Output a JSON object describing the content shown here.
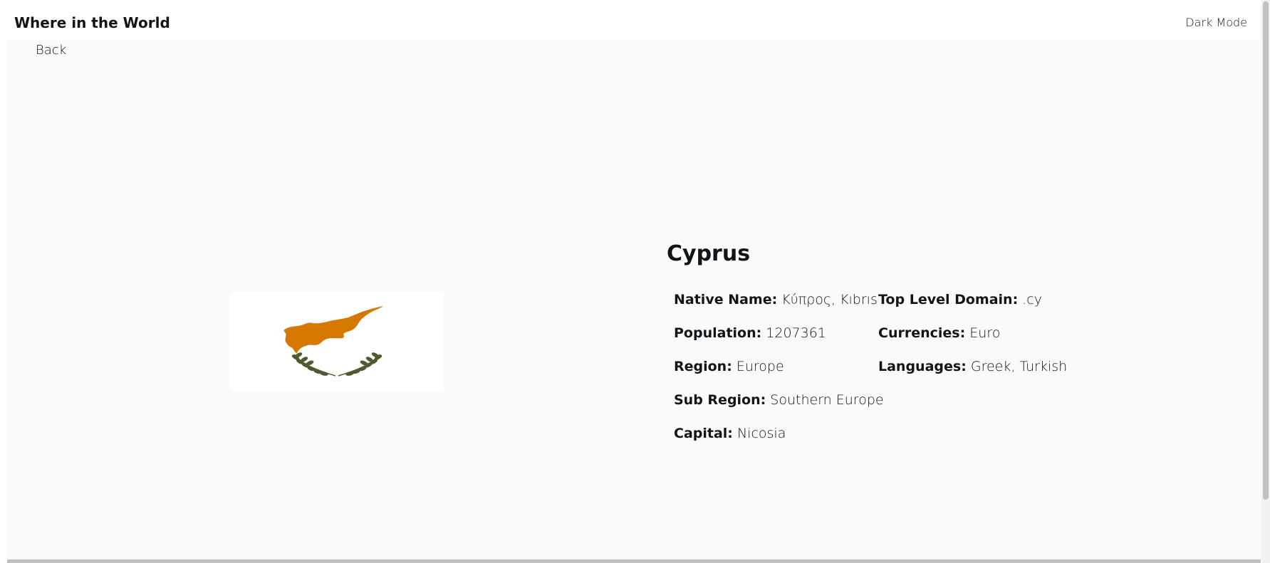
{
  "header": {
    "title": "Where in the World",
    "dark_mode_label": "Dark Mode"
  },
  "nav": {
    "back_label": "Back"
  },
  "country": {
    "name": "Cyprus",
    "native_name_label": "Native Name:",
    "native_name": "Κύπρος, Kıbrıs",
    "population_label": "Population:",
    "population": "1207361",
    "region_label": "Region:",
    "region": "Europe",
    "subregion_label": "Sub Region:",
    "subregion": "Southern Europe",
    "capital_label": "Capital:",
    "capital": "Nicosia",
    "tld_label": "Top Level Domain:",
    "tld": ".cy",
    "currencies_label": "Currencies:",
    "currencies": "Euro",
    "languages_label": "Languages:",
    "languages": "Greek, Turkish"
  },
  "colors": {
    "island": "#d57800",
    "olive": "#4e5b31",
    "background": "#fafafa",
    "text": "#111517"
  }
}
